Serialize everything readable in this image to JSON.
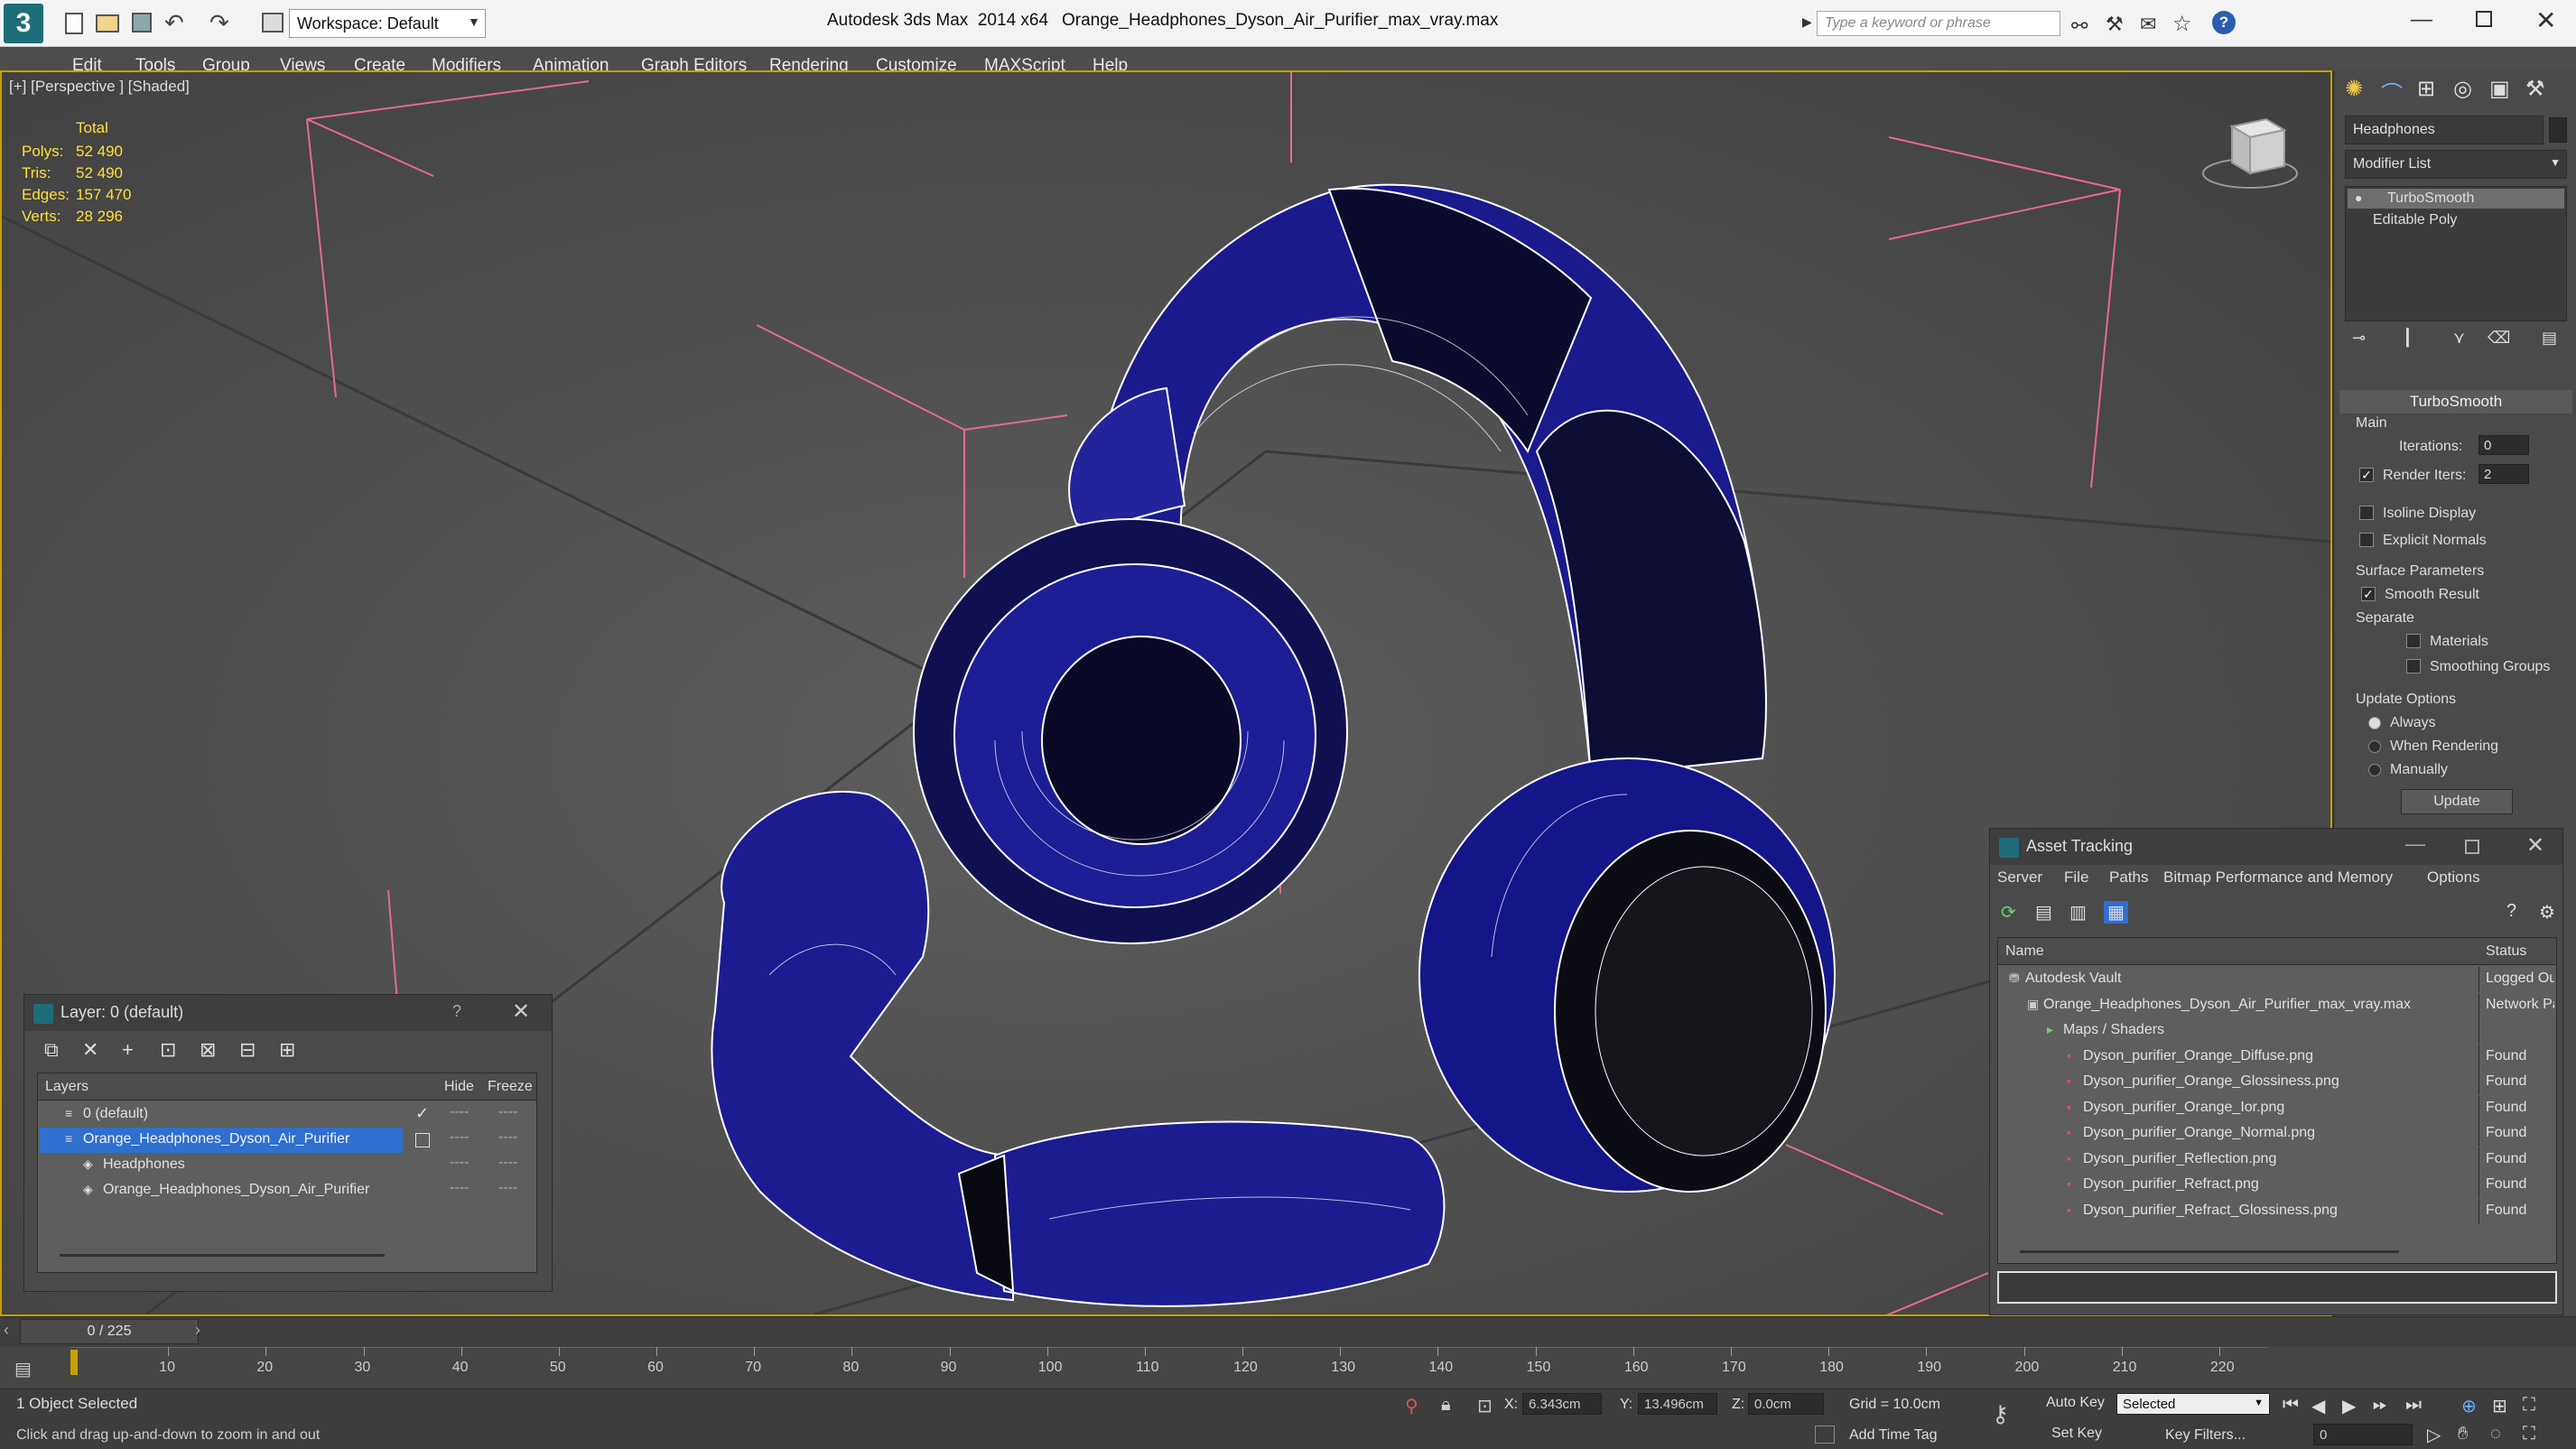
{
  "title_bar": {
    "workspace": "Workspace: Default",
    "app_title": "Autodesk 3ds Max  2014 x64",
    "file_name": "Orange_Headphones_Dyson_Air_Purifier_max_vray.max",
    "search_placeholder": "Type a keyword or phrase"
  },
  "menu": [
    "Edit",
    "Tools",
    "Group",
    "Views",
    "Create",
    "Modifiers",
    "Animation",
    "Graph Editors",
    "Rendering",
    "Customize",
    "MAXScript",
    "Help"
  ],
  "viewport": {
    "label": "[+] [Perspective ] [Shaded]",
    "stats": {
      "header": "Total",
      "rows": [
        {
          "label": "Polys:",
          "value": "52 490"
        },
        {
          "label": "Tris:",
          "value": "52 490"
        },
        {
          "label": "Edges:",
          "value": "157 470"
        },
        {
          "label": "Verts:",
          "value": "28 296"
        }
      ]
    }
  },
  "command_panel": {
    "object_name": "Headphones",
    "modifier_list": "Modifier List",
    "stack": [
      "TurboSmooth",
      "Editable Poly"
    ],
    "rollout_title": "TurboSmooth",
    "main_group": "Main",
    "iterations_label": "Iterations:",
    "iterations_value": "0",
    "render_iters_label": "Render Iters:",
    "render_iters_value": "2",
    "isoline_label": "Isoline Display",
    "explicit_normals_label": "Explicit Normals",
    "surface_params_label": "Surface Parameters",
    "smooth_result_label": "Smooth Result",
    "separate_label": "Separate",
    "materials_label": "Materials",
    "smoothing_groups_label": "Smoothing Groups",
    "update_options_label": "Update Options",
    "always_label": "Always",
    "when_rendering_label": "When Rendering",
    "manually_label": "Manually",
    "update_button": "Update"
  },
  "layer_window": {
    "title": "Layer: 0 (default)",
    "help": "?",
    "col_layers": "Layers",
    "col_hide": "Hide",
    "col_freeze": "Freeze",
    "rows": [
      {
        "name": "0 (default)",
        "dots": "----"
      },
      {
        "name": "Orange_Headphones_Dyson_Air_Purifier",
        "dots": "----"
      },
      {
        "name": "Headphones",
        "dots": "----"
      },
      {
        "name": "Orange_Headphones_Dyson_Air_Purifier",
        "dots": "----"
      }
    ]
  },
  "asset_window": {
    "title": "Asset Tracking",
    "menu": [
      "Server",
      "File",
      "Paths",
      "Bitmap Performance and Memory",
      "Options"
    ],
    "col_name": "Name",
    "col_status": "Status",
    "rows": [
      {
        "name": "Autodesk Vault",
        "status": "Logged Ou"
      },
      {
        "name": "Orange_Headphones_Dyson_Air_Purifier_max_vray.max",
        "status": "Network Pa"
      },
      {
        "name": "Maps / Shaders",
        "status": ""
      },
      {
        "name": "Dyson_purifier_Orange_Diffuse.png",
        "status": "Found"
      },
      {
        "name": "Dyson_purifier_Orange_Glossiness.png",
        "status": "Found"
      },
      {
        "name": "Dyson_purifier_Orange_Ior.png",
        "status": "Found"
      },
      {
        "name": "Dyson_purifier_Orange_Normal.png",
        "status": "Found"
      },
      {
        "name": "Dyson_purifier_Reflection.png",
        "status": "Found"
      },
      {
        "name": "Dyson_purifier_Refract.png",
        "status": "Found"
      },
      {
        "name": "Dyson_purifier_Refract_Glossiness.png",
        "status": "Found"
      }
    ]
  },
  "timeline": {
    "frame_label": "0 / 225",
    "ticks": [
      "10",
      "20",
      "30",
      "40",
      "50",
      "60",
      "70",
      "80",
      "90",
      "100",
      "110",
      "120",
      "130",
      "140",
      "150",
      "160",
      "170",
      "180",
      "190",
      "200",
      "210",
      "220"
    ]
  },
  "status_bar": {
    "selection": "1 Object Selected",
    "prompt": "Click and drag up-and-down to zoom in and out",
    "x_label": "X:",
    "x_value": "6.343cm",
    "y_label": "Y:",
    "y_value": "13.496cm",
    "z_label": "Z:",
    "z_value": "0.0cm",
    "grid": "Grid = 10.0cm",
    "add_time_tag": "Add Time Tag",
    "auto_key": "Auto Key",
    "set_key": "Set Key",
    "selected": "Selected",
    "key_filters": "Key Filters...",
    "frame_value": "0"
  },
  "colors": {
    "accent": "#c8a000",
    "selection": "#2f6fcf",
    "mesh_blue": "#1b1b8f",
    "wire": "#ffffff"
  }
}
